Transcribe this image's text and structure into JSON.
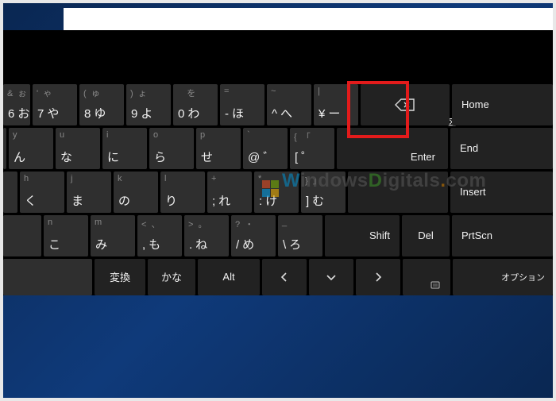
{
  "watermark": {
    "w": "W",
    "mid1": "indows",
    "d": "D",
    "mid2": "igitals",
    "dot": ".",
    "tld": "com"
  },
  "close_glyph": "⊠",
  "side": {
    "home": "Home",
    "end": "End",
    "insert": "Insert",
    "prtscn": "PrtScn",
    "option": "オプション"
  },
  "row1": [
    {
      "sup": "&  ぉ",
      "p1": "6",
      "p2": "お"
    },
    {
      "sup": "'  ゃ",
      "p1": "7",
      "p2": "や"
    },
    {
      "sup": "(  ゅ",
      "p1": "8",
      "p2": "ゆ"
    },
    {
      "sup": ")  ょ",
      "p1": "9",
      "p2": "よ"
    },
    {
      "sup": "    を",
      "p1": "0",
      "p2": "わ"
    },
    {
      "sup": "=",
      "p1": "-",
      "p2": "ほ"
    },
    {
      "sup": "~",
      "p1": "^",
      "p2": "へ"
    },
    {
      "sup": "|",
      "p1": "¥",
      "p2": "ー"
    }
  ],
  "row2": [
    {
      "sup": "y",
      "p2": "ん"
    },
    {
      "sup": "u",
      "p2": "な"
    },
    {
      "sup": "i",
      "p2": "に"
    },
    {
      "sup": "o",
      "p2": "ら"
    },
    {
      "sup": "p",
      "p2": "せ"
    },
    {
      "sup": "`",
      "p1": "@",
      "p2": "゛"
    },
    {
      "sup": "{  「",
      "p1": "[",
      "p2": "゜"
    }
  ],
  "enter": "Enter",
  "row3": [
    {
      "sup": "h",
      "p2": "く"
    },
    {
      "sup": "j",
      "p2": "ま"
    },
    {
      "sup": "k",
      "p2": "の"
    },
    {
      "sup": "l",
      "p2": "り"
    },
    {
      "sup": "+",
      "p1": ";",
      "p2": "れ"
    },
    {
      "sup": "*",
      "p1": ":",
      "p2": "け"
    },
    {
      "sup": "}  」",
      "p1": "]",
      "p2": "む"
    }
  ],
  "row4": [
    {
      "sup": "n",
      "p2": "こ"
    },
    {
      "sup": "m",
      "p2": "み"
    },
    {
      "sup": "<  、",
      "p1": ",",
      "p2": "も"
    },
    {
      "sup": ">  。",
      "p1": ".",
      "p2": "ね"
    },
    {
      "sup": "?  ・",
      "p1": "/",
      "p2": "め"
    },
    {
      "sup": "_",
      "p1": "\\",
      "p2": "ろ"
    }
  ],
  "shift": "Shift",
  "del": "Del",
  "row5": {
    "henkan": "変換",
    "kana": "かな",
    "alt": "Alt"
  }
}
